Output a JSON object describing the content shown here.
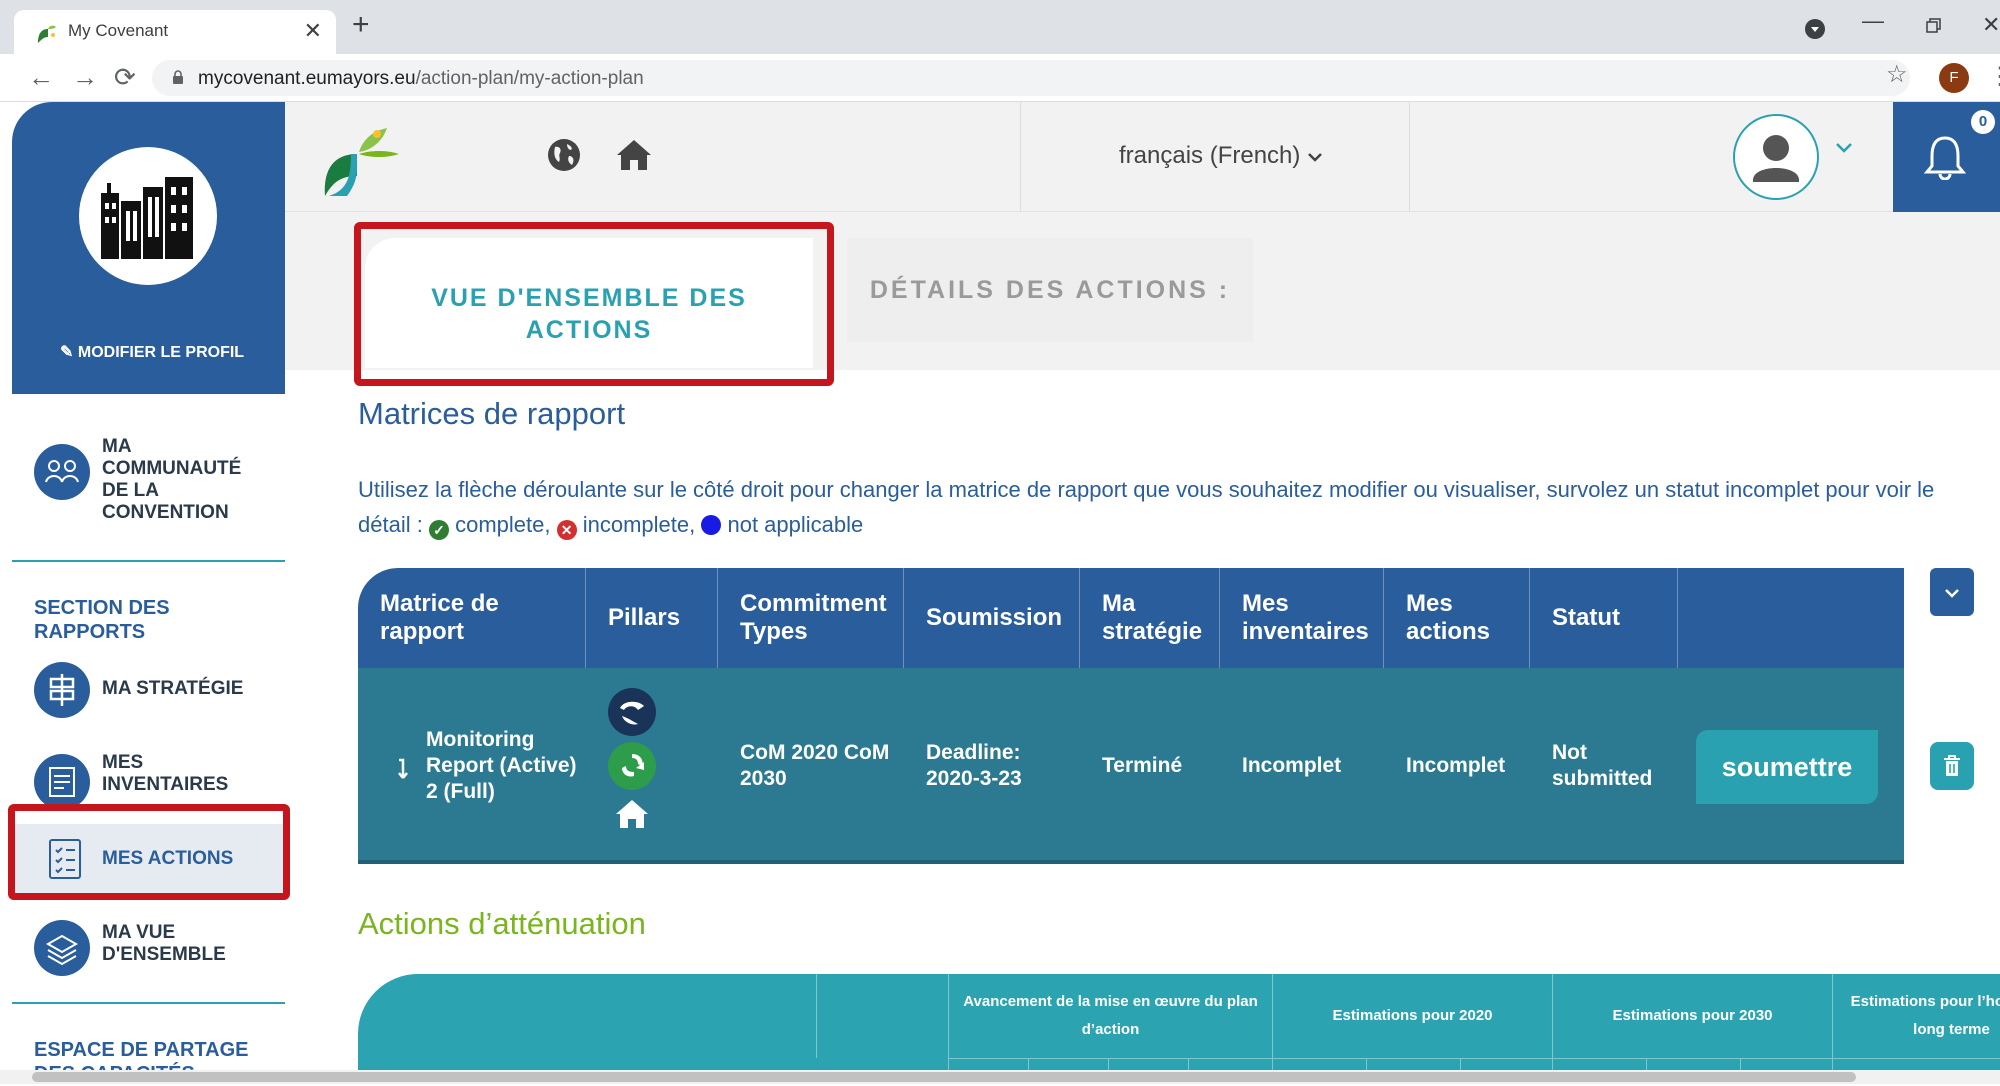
{
  "browser": {
    "tab_title": "My Covenant",
    "tab_close": "✕",
    "new_tab": "+",
    "url_domain": "mycovenant.eumayors.eu",
    "url_path": "/action-plan/my-action-plan",
    "profile_initial": "F"
  },
  "sidebar": {
    "modify_profile": "MODIFIER LE PROFIL",
    "community": "MA COMMUNAUTÉ DE LA CONVENTION",
    "reports_section": "SECTION DES RAPPORTS",
    "items": [
      {
        "label": "MA STRATÉGIE"
      },
      {
        "label": "MES INVENTAIRES"
      },
      {
        "label": "MES ACTIONS"
      },
      {
        "label": "MA VUE D'ENSEMBLE"
      }
    ],
    "sharing_section": "ESPACE DE PARTAGE DES CAPACITÉS"
  },
  "topbar": {
    "language": "français (French)",
    "notifications": "0"
  },
  "tabs": {
    "overview": "VUE D'ENSEMBLE DES ACTIONS",
    "details": "DÉTAILS DES ACTIONS :"
  },
  "main": {
    "heading": "Matrices de rapport",
    "intro_text": "Utilisez la flèche déroulante sur le côté droit pour changer la matrice de rapport que vous souhaitez modifier ou visualiser, survolez un statut incomplet pour voir le détail :",
    "legend": {
      "complete": "complete,",
      "incomplete": "incomplete,",
      "not_applicable": "not applicable"
    },
    "mitigation_heading": "Actions d’atténuation"
  },
  "report_table": {
    "headers": [
      "Matrice de rapport",
      "Pillars",
      "Commitment Types",
      "Soumission",
      "Ma stratégie",
      "Mes inventaires",
      "Mes actions",
      "Statut"
    ],
    "row": {
      "matrix": "Monitoring Report (Active) 2 (Full)",
      "commitment_types": "CoM 2020 CoM 2030",
      "submission": "Deadline: 2020-3-23",
      "strategy": "Terminé",
      "inventories": "Incomplet",
      "actions": "Incomplet",
      "status": "Not submitted",
      "submit_label": "soumettre"
    }
  },
  "mitigation_table": {
    "headers": [
      "Avancement de la mise en œuvre du plan d’action",
      "Estimations pour 2020",
      "Estimations pour 2030",
      "Estimations pour l’horizon à long terme"
    ]
  },
  "colors": {
    "primary_blue": "#2a5d9c",
    "teal": "#2aa1b0",
    "row_teal": "#2b7a92",
    "mitigation_green": "#7ab51d",
    "highlight_red": "#c4161c"
  }
}
